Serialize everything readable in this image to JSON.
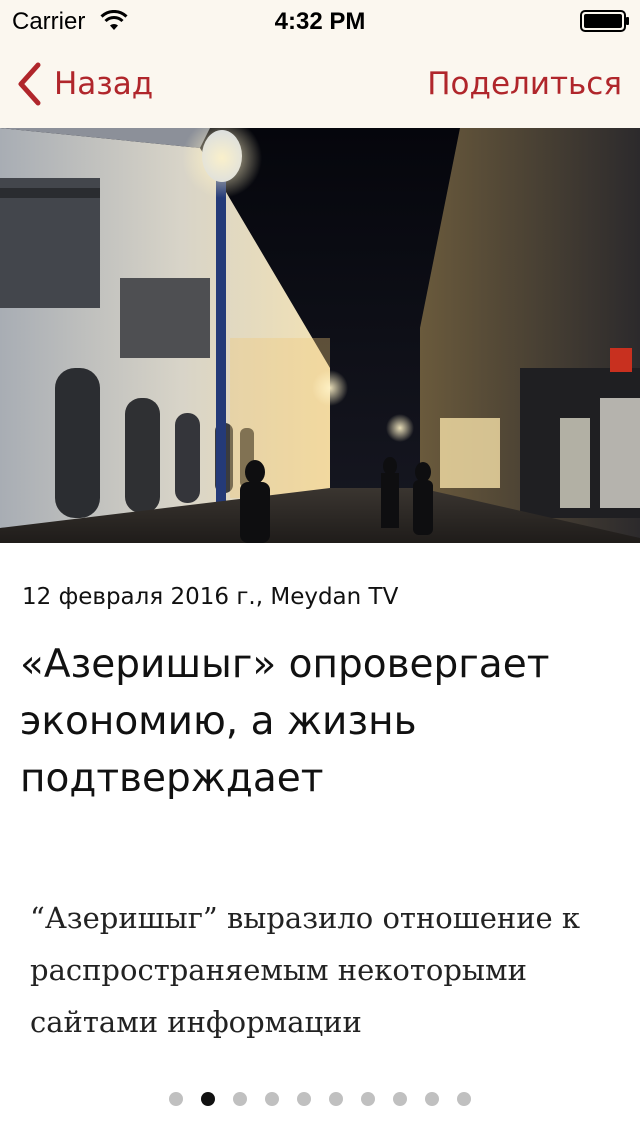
{
  "status_bar": {
    "carrier": "Carrier",
    "time": "4:32 PM"
  },
  "nav": {
    "back_label": "Назад",
    "share_label": "Поделиться",
    "accent_color": "#b0262b",
    "background_color": "#fbf7ef"
  },
  "article": {
    "meta": "12 февраля 2016 г., Meydan TV",
    "title": "«Азеришыг» опровергает экономию, а жизнь подтверждает",
    "summary": "“Азеришыг” выразило отношение к распространяемым некоторыми сайтами информации",
    "image_description": "night-street-photo"
  },
  "pager": {
    "total": 10,
    "active": 2
  }
}
